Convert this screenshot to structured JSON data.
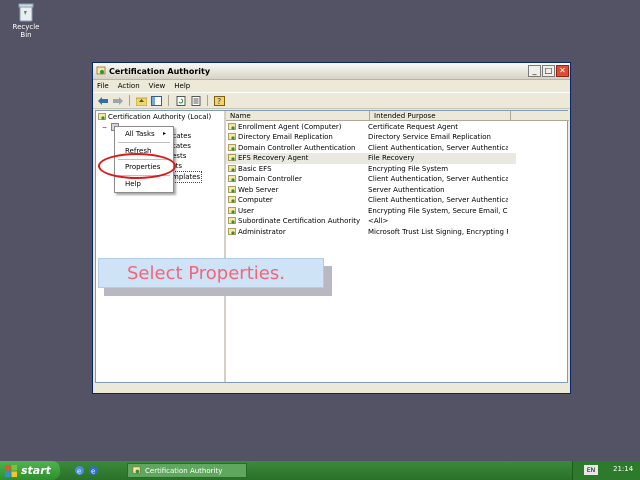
{
  "desktop": {
    "recycle_bin_label": "Recycle Bin"
  },
  "window": {
    "title": "Certification Authority",
    "menu": [
      "File",
      "Action",
      "View",
      "Help"
    ],
    "tree": {
      "root": "Certification Authority (Local)",
      "child_label": "",
      "partial_items": [
        "ificates",
        "cates",
        "ests",
        "sts",
        "mplates"
      ]
    },
    "context_menu": {
      "items": [
        "All Tasks",
        "Refresh",
        "Properties",
        "Help"
      ]
    },
    "columns": {
      "name": "Name",
      "purpose": "Intended Purpose"
    },
    "rows": [
      {
        "name": "Enrollment Agent (Computer)",
        "purpose": "Certificate Request Agent"
      },
      {
        "name": "Directory Email Replication",
        "purpose": "Directory Service Email Replication"
      },
      {
        "name": "Domain Controller Authentication",
        "purpose": "Client Authentication, Server Authenticatio..."
      },
      {
        "name": "EFS Recovery Agent",
        "purpose": "File Recovery"
      },
      {
        "name": "Basic EFS",
        "purpose": "Encrypting File System"
      },
      {
        "name": "Domain Controller",
        "purpose": "Client Authentication, Server Authentication"
      },
      {
        "name": "Web Server",
        "purpose": "Server Authentication"
      },
      {
        "name": "Computer",
        "purpose": "Client Authentication, Server Authentication"
      },
      {
        "name": "User",
        "purpose": "Encrypting File System, Secure Email, Clien..."
      },
      {
        "name": "Subordinate Certification Authority",
        "purpose": "<All>"
      },
      {
        "name": "Administrator",
        "purpose": "Microsoft Trust List Signing, Encrypting File..."
      }
    ]
  },
  "callout": {
    "text": "Select Properties."
  },
  "taskbar": {
    "start_label": "start",
    "task_label": "Certification Authority",
    "lang": "EN",
    "clock": "21:14"
  },
  "colors": {
    "desktop": "#545366",
    "highlight_ring": "#d81b1b",
    "callout_text": "#f4647a",
    "callout_bg": "#cfe3f6",
    "taskbar": "#2a702a"
  }
}
